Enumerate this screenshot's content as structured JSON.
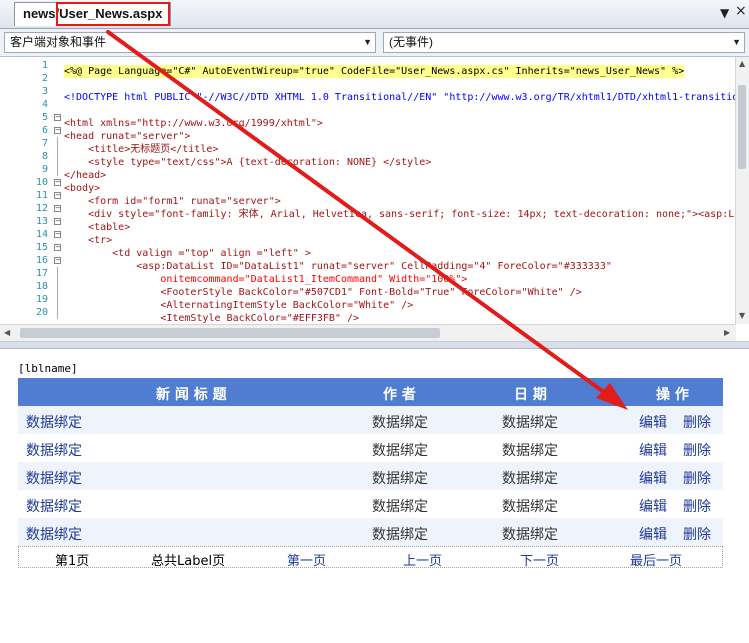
{
  "tab": {
    "title": "news/User_News.aspx",
    "pin": "▼",
    "close": "×"
  },
  "combos": {
    "left": "客户端对象和事件",
    "right": "(无事件)"
  },
  "code": {
    "line_numbers": [
      "1",
      "2",
      "3",
      "4",
      "5",
      "6",
      "7",
      "8",
      "9",
      "10",
      "11",
      "12",
      "13",
      "14",
      "15",
      "16",
      "17",
      "18",
      "19",
      "20"
    ],
    "lines": [
      "<%@ Page Language=\"C#\" AutoEventWireup=\"true\" CodeFile=\"User_News.aspx.cs\" Inherits=\"news_User_News\" %>",
      "",
      "<!DOCTYPE html PUBLIC \"-//W3C//DTD XHTML 1.0 Transitional//EN\" \"http://www.w3.org/TR/xhtml1/DTD/xhtml1-transitio",
      "",
      "<html xmlns=\"http://www.w3.org/1999/xhtml\">",
      "<head runat=\"server\">",
      "    <title>无标题页</title>",
      "    <style type=\"text/css\">A {text-decoration: NONE} </style>",
      "</head>",
      "<body>",
      "    <form id=\"form1\" runat=\"server\">",
      "    <div style=\"font-family: 宋体, Arial, Helvetica, sans-serif; font-size: 14px; text-decoration: none;\"><asp:L",
      "    <table>",
      "    <tr>",
      "        <td valign =\"top\" align =\"left\" >",
      "            <asp:DataList ID=\"DataList1\" runat=\"server\" CellPadding=\"4\" ForeColor=\"#333333\"",
      "                onitemcommand=\"DataList1_ItemCommand\" Width=\"100%\">",
      "                <FooterStyle BackColor=\"#507CD1\" Font-Bold=\"True\" ForeColor=\"White\" />",
      "                <AlternatingItemStyle BackColor=\"White\" />",
      "                <ItemStyle BackColor=\"#EFF3FB\" />"
    ]
  },
  "design": {
    "label": "[lblname]",
    "headers": {
      "title": "新 闻 标 题",
      "author": "作 者",
      "date": "日 期",
      "action": "操 作"
    },
    "rows": [
      {
        "title": "数据绑定",
        "author": "数据绑定",
        "date": "数据绑定",
        "edit": "编辑",
        "delete": "删除"
      },
      {
        "title": "数据绑定",
        "author": "数据绑定",
        "date": "数据绑定",
        "edit": "编辑",
        "delete": "删除"
      },
      {
        "title": "数据绑定",
        "author": "数据绑定",
        "date": "数据绑定",
        "edit": "编辑",
        "delete": "删除"
      },
      {
        "title": "数据绑定",
        "author": "数据绑定",
        "date": "数据绑定",
        "edit": "编辑",
        "delete": "删除"
      },
      {
        "title": "数据绑定",
        "author": "数据绑定",
        "date": "数据绑定",
        "edit": "编辑",
        "delete": "删除"
      }
    ],
    "pager": {
      "current": "第1页",
      "total": "总共Label页",
      "first": "第一页",
      "prev": "上一页",
      "next": "下一页",
      "last": "最后一页"
    }
  },
  "colors": {
    "header_bg": "#507CD1",
    "item_bg": "#EFF3FB",
    "alt_bg": "#FFFFFF",
    "annotation": "#E21B1B"
  }
}
